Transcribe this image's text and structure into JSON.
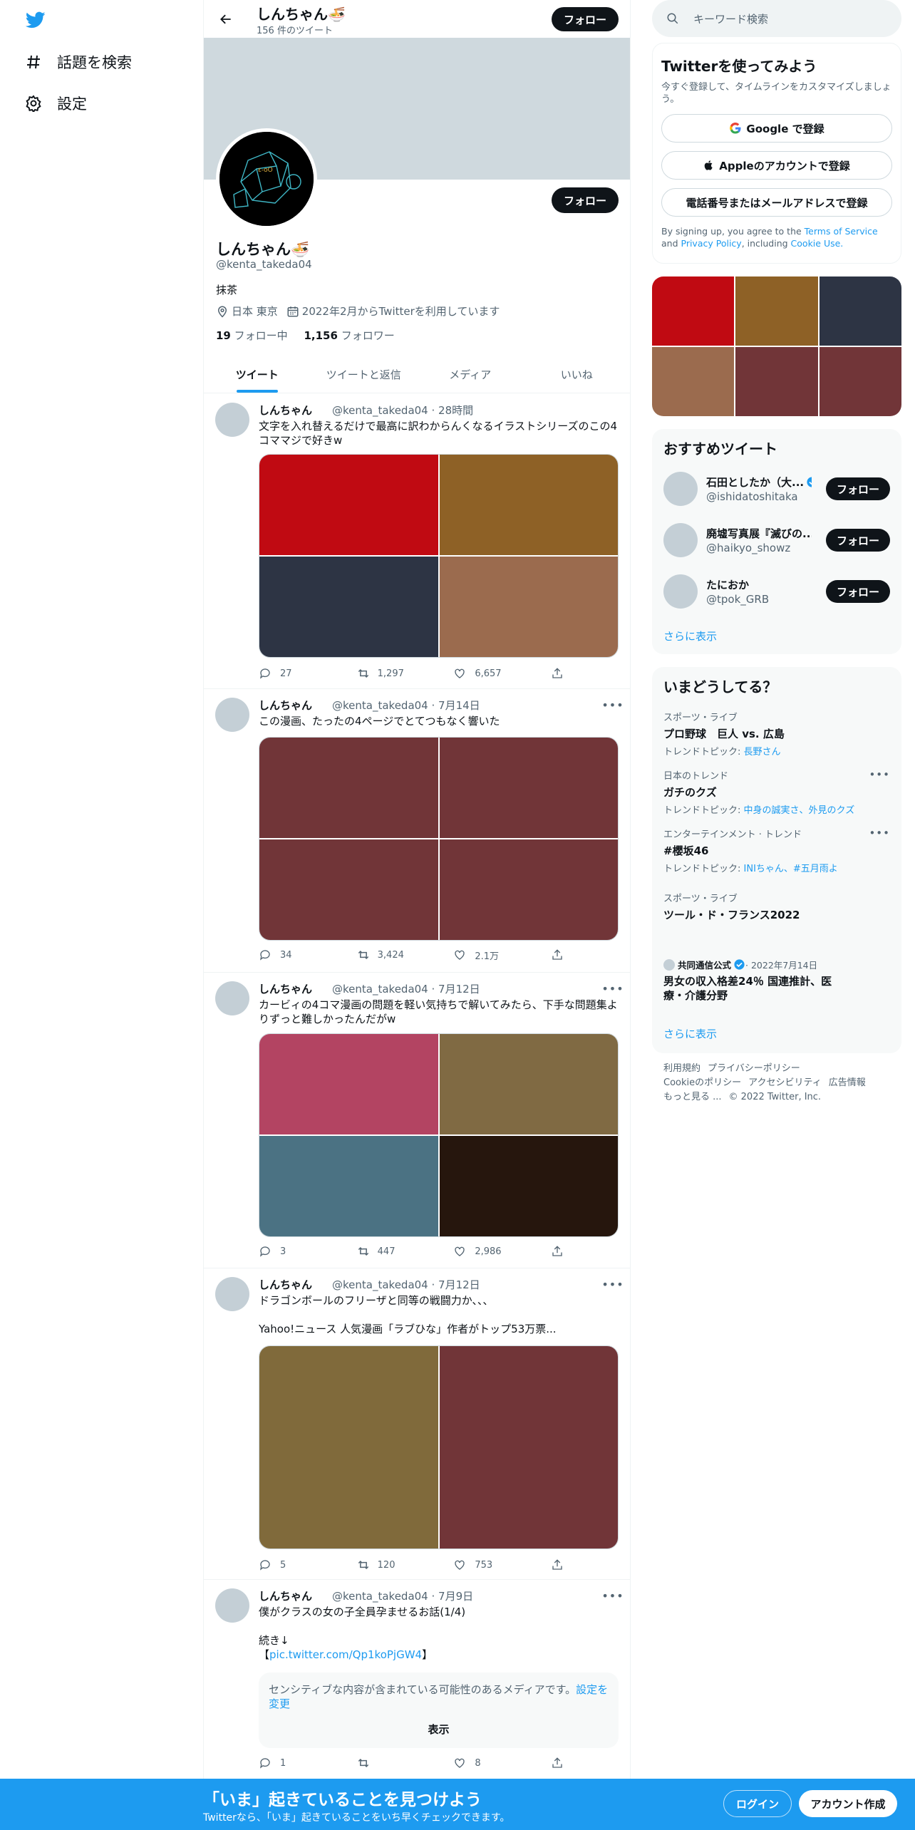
{
  "nav": {
    "explore_label": "話題を検索",
    "settings_label": "設定"
  },
  "header": {
    "title": "しんちゃん🍜",
    "tweet_count": "156 件のツイート",
    "follow_label": "フォロー"
  },
  "profile": {
    "name": "しんちゃん🍜",
    "handle": "@kenta_takeda04",
    "bio": "抹茶",
    "location": "日本 東京",
    "joined": "2022年2月からTwitterを利用しています",
    "following_count": "19",
    "following_label": "フォロー中",
    "followers_count": "1,156",
    "followers_label": "フォロワー",
    "follow_label": "フォロー"
  },
  "tabs": [
    {
      "label": "ツイート"
    },
    {
      "label": "ツイートと返信"
    },
    {
      "label": "メディア"
    },
    {
      "label": "いいね"
    }
  ],
  "tweets": [
    {
      "name": "しんちゃん",
      "handle_time": "@kenta_takeda04 · 28時間",
      "text": "文字を入れ替えるだけで最高に訳わからんくなるイラストシリーズのこの4コママジで好きw",
      "media_colors": [
        "#c00a12",
        "#8e6126",
        "#2d3444",
        "#9b6b4e"
      ],
      "replies": "27",
      "retweets": "1,297",
      "likes": "6,657"
    },
    {
      "name": "しんちゃん",
      "handle_time": "@kenta_takeda04 · 7月14日",
      "text": "この漫画、たったの4ページでとてつもなく響いた",
      "media_colors": [
        "#713538",
        "#713538",
        "#713538",
        "#713538"
      ],
      "replies": "34",
      "retweets": "3,424",
      "likes": "2.1万"
    },
    {
      "name": "しんちゃん",
      "handle_time": "@kenta_takeda04 · 7月12日",
      "text": "カービィの4コマ漫画の問題を軽い気持ちで解いてみたら、下手な問題集よりずっと難しかったんだがw",
      "media_colors": [
        "#b34462",
        "#806a43",
        "#4b7283",
        "#26160d"
      ],
      "replies": "3",
      "retweets": "447",
      "likes": "2,986"
    },
    {
      "name": "しんちゃん",
      "handle_time": "@kenta_takeda04 · 7月12日",
      "text": "ドラゴンボールのフリーザと同等の戦闘力か、、、\n\nYahoo!ニュース 人気漫画「ラブひな」作者がトップ53万票...",
      "media_colors": [
        "#806a3b",
        "#713538"
      ],
      "replies": "5",
      "retweets": "120",
      "likes": "753"
    },
    {
      "name": "しんちゃん",
      "handle_time": "@kenta_takeda04 · 7月9日",
      "text_main": "僕がクラスの女の子全員孕ませるお話(1/4)\n\n続き↓\n【",
      "text_link": "pic.twitter.com/Qp1koPjGW4",
      "text_end": "】",
      "sensitive_text": "センシティブな内容が含まれている可能性のあるメディアです。",
      "sensitive_link": "設定を変更",
      "show_label": "表示",
      "replies": "1",
      "retweets": "",
      "likes": "8"
    }
  ],
  "sidebar": {
    "search_placeholder": "キーワード検索",
    "signup": {
      "title": "Twitterを使ってみよう",
      "desc": "今すぐ登録して、タイムラインをカスタマイズしましょう。",
      "google": "Google で登録",
      "apple": "Appleのアカウントで登録",
      "phone": "電話番号またはメールアドレスで登録",
      "terms_pre": "By signing up, you agree to the ",
      "terms": "Terms of Service",
      "terms_and": " and ",
      "privacy": "Privacy Policy",
      "including": ", including ",
      "cookie": "Cookie Use."
    },
    "media_colors": [
      "#c00a12",
      "#8e6126",
      "#2d3444",
      "#9b6b4e",
      "#713538",
      "#713538"
    ],
    "recommend": {
      "title": "おすすめツイート",
      "users": [
        {
          "name": "石田としたか（大...",
          "handle": "@ishidatoshitaka",
          "verified": true
        },
        {
          "name": "廃墟写真展『滅びの...",
          "handle": "@haikyo_showz",
          "verified": false
        },
        {
          "name": "たにおか",
          "handle": "@tpok_GRB",
          "verified": false
        }
      ],
      "follow_label": "フォロー",
      "more": "さらに表示"
    },
    "trends": {
      "title": "いまどうしてる？",
      "items": [
        {
          "category": "スポーツ・ライブ",
          "title": "プロ野球　巨人 vs. 広島",
          "related_label": "トレンドトピック: ",
          "related": "長野さん"
        },
        {
          "category": "日本のトレンド",
          "title": "ガチのクズ",
          "related_label": "トレンドトピック: ",
          "related": "中身の誠実さ、外見のクズ"
        },
        {
          "category": "エンターテインメント · トレンド",
          "title": "#櫻坂46",
          "related_label": "トレンドトピック: ",
          "related": "INIちゃん、#五月雨よ"
        },
        {
          "category": "スポーツ・ライブ",
          "title": "ツール・ド・フランス2022",
          "related_label": "",
          "related": ""
        }
      ],
      "news_source": "共同通信公式",
      "news_date": " · 2022年7月14日",
      "news_title": "男女の収入格差24％ 国連推計、医療・介護分野",
      "more": "さらに表示"
    },
    "footer": {
      "terms": "利用規約",
      "privacy": "プライバシーポリシー",
      "cookie": "Cookieのポリシー",
      "accessibility": "アクセシビリティ",
      "ads": "広告情報",
      "more": "もっと見る ...",
      "copyright": "© 2022 Twitter, Inc."
    }
  },
  "bottom_bar": {
    "title": "「いま」起きていることを見つけよう",
    "subtitle": "Twitterなら、「いま」起きていることをいち早くチェックできます。",
    "login": "ログイン",
    "signup": "アカウント作成"
  },
  "colors": {
    "accent": "#1d9bf0",
    "dark": "#0f1419",
    "banner": "#cfd9de"
  }
}
